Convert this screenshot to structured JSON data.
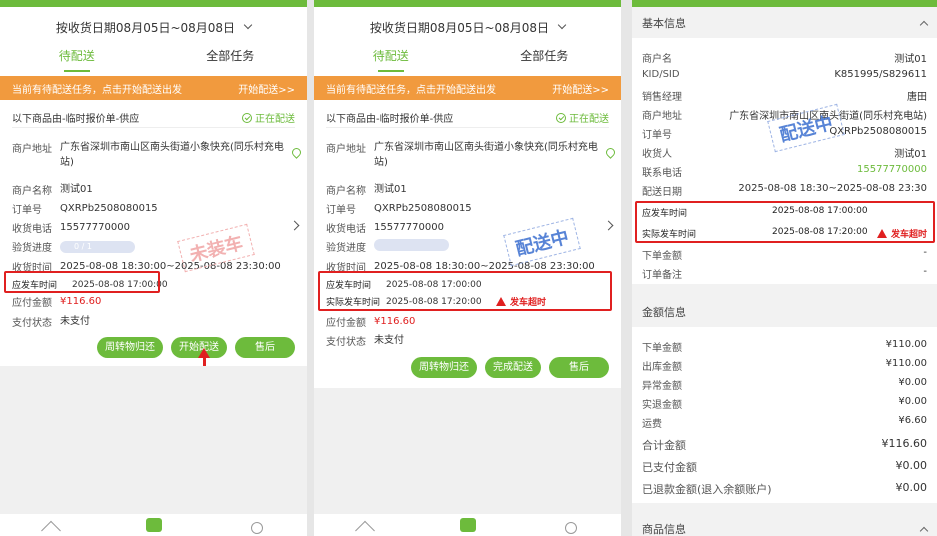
{
  "screens": [
    {
      "date_range": "按收货日期08月05日~08月08日",
      "tabs": [
        "待配送",
        "全部任务"
      ],
      "banner_text": "当前有待配送任务，点击开始配送出发",
      "banner_action": "开始配送>>",
      "card_title": "以下商品由-临时报价单-供应",
      "status": "正在配送",
      "address_label": "商户地址",
      "address": "广东省深圳市南山区南头街道小象快充(同乐村充电站)",
      "merchant_label": "商户名称",
      "merchant": "测试01",
      "order_label": "订单号",
      "order": "QXRPb2508080015",
      "phone_label": "收货电话",
      "phone": "15577770000",
      "progress_label": "验货进度",
      "progress": "0 / 1",
      "time_label": "收货时间",
      "time": "2025-08-08 18:30:00~2025-08-08 23:30:00",
      "depart_label": "应发车时间",
      "depart": "2025-08-08 17:00:00",
      "amount_label": "应付金额",
      "amount": "¥116.60",
      "pay_label": "支付状态",
      "pay": "未支付",
      "stamp": "未装车",
      "buttons": [
        "周转物归还",
        "开始配送",
        "售后"
      ]
    },
    {
      "date_range": "按收货日期08月05日~08月08日",
      "tabs": [
        "待配送",
        "全部任务"
      ],
      "banner_text": "当前有待配送任务，点击开始配送出发",
      "banner_action": "开始配送>>",
      "card_title": "以下商品由-临时报价单-供应",
      "status": "正在配送",
      "address_label": "商户地址",
      "address": "广东省深圳市南山区南头街道小象快充(同乐村充电站)",
      "merchant_label": "商户名称",
      "merchant": "测试01",
      "order_label": "订单号",
      "order": "QXRPb2508080015",
      "phone_label": "收货电话",
      "phone": "15577770000",
      "progress_label": "验货进度",
      "time_label": "收货时间",
      "time": "2025-08-08 18:30:00~2025-08-08 23:30:00",
      "depart_label": "应发车时间",
      "depart": "2025-08-08  17:00:00",
      "actual_label": "实际发车时间",
      "actual": "2025-08-08  17:20:00",
      "overtime": "发车超时",
      "amount_label": "应付金额",
      "amount": "¥116.60",
      "pay_label": "支付状态",
      "pay": "未支付",
      "stamp": "配送中",
      "buttons": [
        "周转物归还",
        "完成配送",
        "售后"
      ]
    }
  ],
  "detail": {
    "basic_title": "基本信息",
    "rows": [
      {
        "k": "商户名",
        "v": "测试01"
      },
      {
        "k": "KID/SID",
        "v": "K851995/S829611"
      },
      {
        "k": "销售经理",
        "v": "唐田"
      },
      {
        "k": "商户地址",
        "v": "广东省深圳市南山区南头街道(同乐村充电站)"
      },
      {
        "k": "订单号",
        "v": "QXRPb2508080015"
      },
      {
        "k": "收货人",
        "v": "测试01"
      },
      {
        "k": "联系电话",
        "v": "15577770000"
      },
      {
        "k": "配送日期",
        "v": "2025-08-08 18:30~2025-08-08 23:30"
      }
    ],
    "depart_label": "应发车时间",
    "depart": "2025-08-08  17:00:00",
    "actual_label": "实际发车时间",
    "actual": "2025-08-08  17:20:00",
    "overtime": "发车超时",
    "rows2": [
      {
        "k": "下单金额",
        "v": "-"
      },
      {
        "k": "订单备注",
        "v": "-"
      }
    ],
    "stamp": "配送中",
    "amount_title": "金额信息",
    "amounts": [
      {
        "k": "下单金额",
        "v": "¥110.00"
      },
      {
        "k": "出库金额",
        "v": "¥110.00"
      },
      {
        "k": "异常金额",
        "v": "¥0.00"
      },
      {
        "k": "实退金额",
        "v": "¥0.00"
      },
      {
        "k": "运费",
        "v": "¥6.60"
      }
    ],
    "total_label": "合计金额",
    "total": "¥116.60",
    "paid_label": "已支付金额",
    "paid": "¥0.00",
    "refund_label": "已退款金额(退入余额账户)",
    "refund": "¥0.00",
    "goods_title": "商品信息"
  },
  "colors": {
    "accent": "#6dbb3c",
    "banner": "#f19a3e",
    "alert": "#e02020"
  }
}
